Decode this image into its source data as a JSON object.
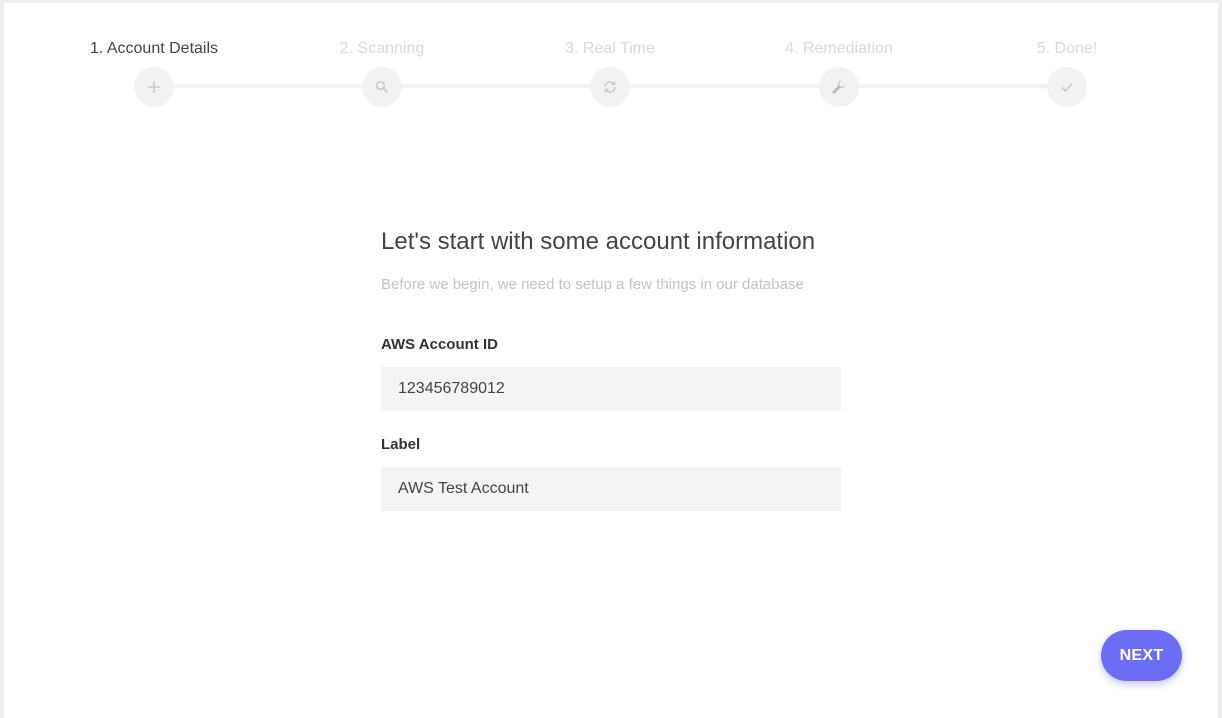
{
  "stepper": {
    "steps": [
      {
        "label": "1. Account Details",
        "icon": "plus-icon",
        "active": true
      },
      {
        "label": "2. Scanning",
        "icon": "search-icon",
        "active": false
      },
      {
        "label": "3. Real Time",
        "icon": "sync-icon",
        "active": false
      },
      {
        "label": "4. Remediation",
        "icon": "wrench-icon",
        "active": false
      },
      {
        "label": "5. Done!",
        "icon": "check-icon",
        "active": false
      }
    ],
    "active_color": "#444444",
    "inactive_color": "#dadada"
  },
  "form": {
    "title": "Let's start with some account information",
    "subtitle": "Before we begin, we need to setup a few things in our database",
    "account_id": {
      "label": "AWS Account ID",
      "value": "123456789012"
    },
    "label_field": {
      "label": "Label",
      "value": "AWS Test Account"
    }
  },
  "actions": {
    "next_label": "NEXT",
    "accent_color": "#6b6ef5"
  }
}
